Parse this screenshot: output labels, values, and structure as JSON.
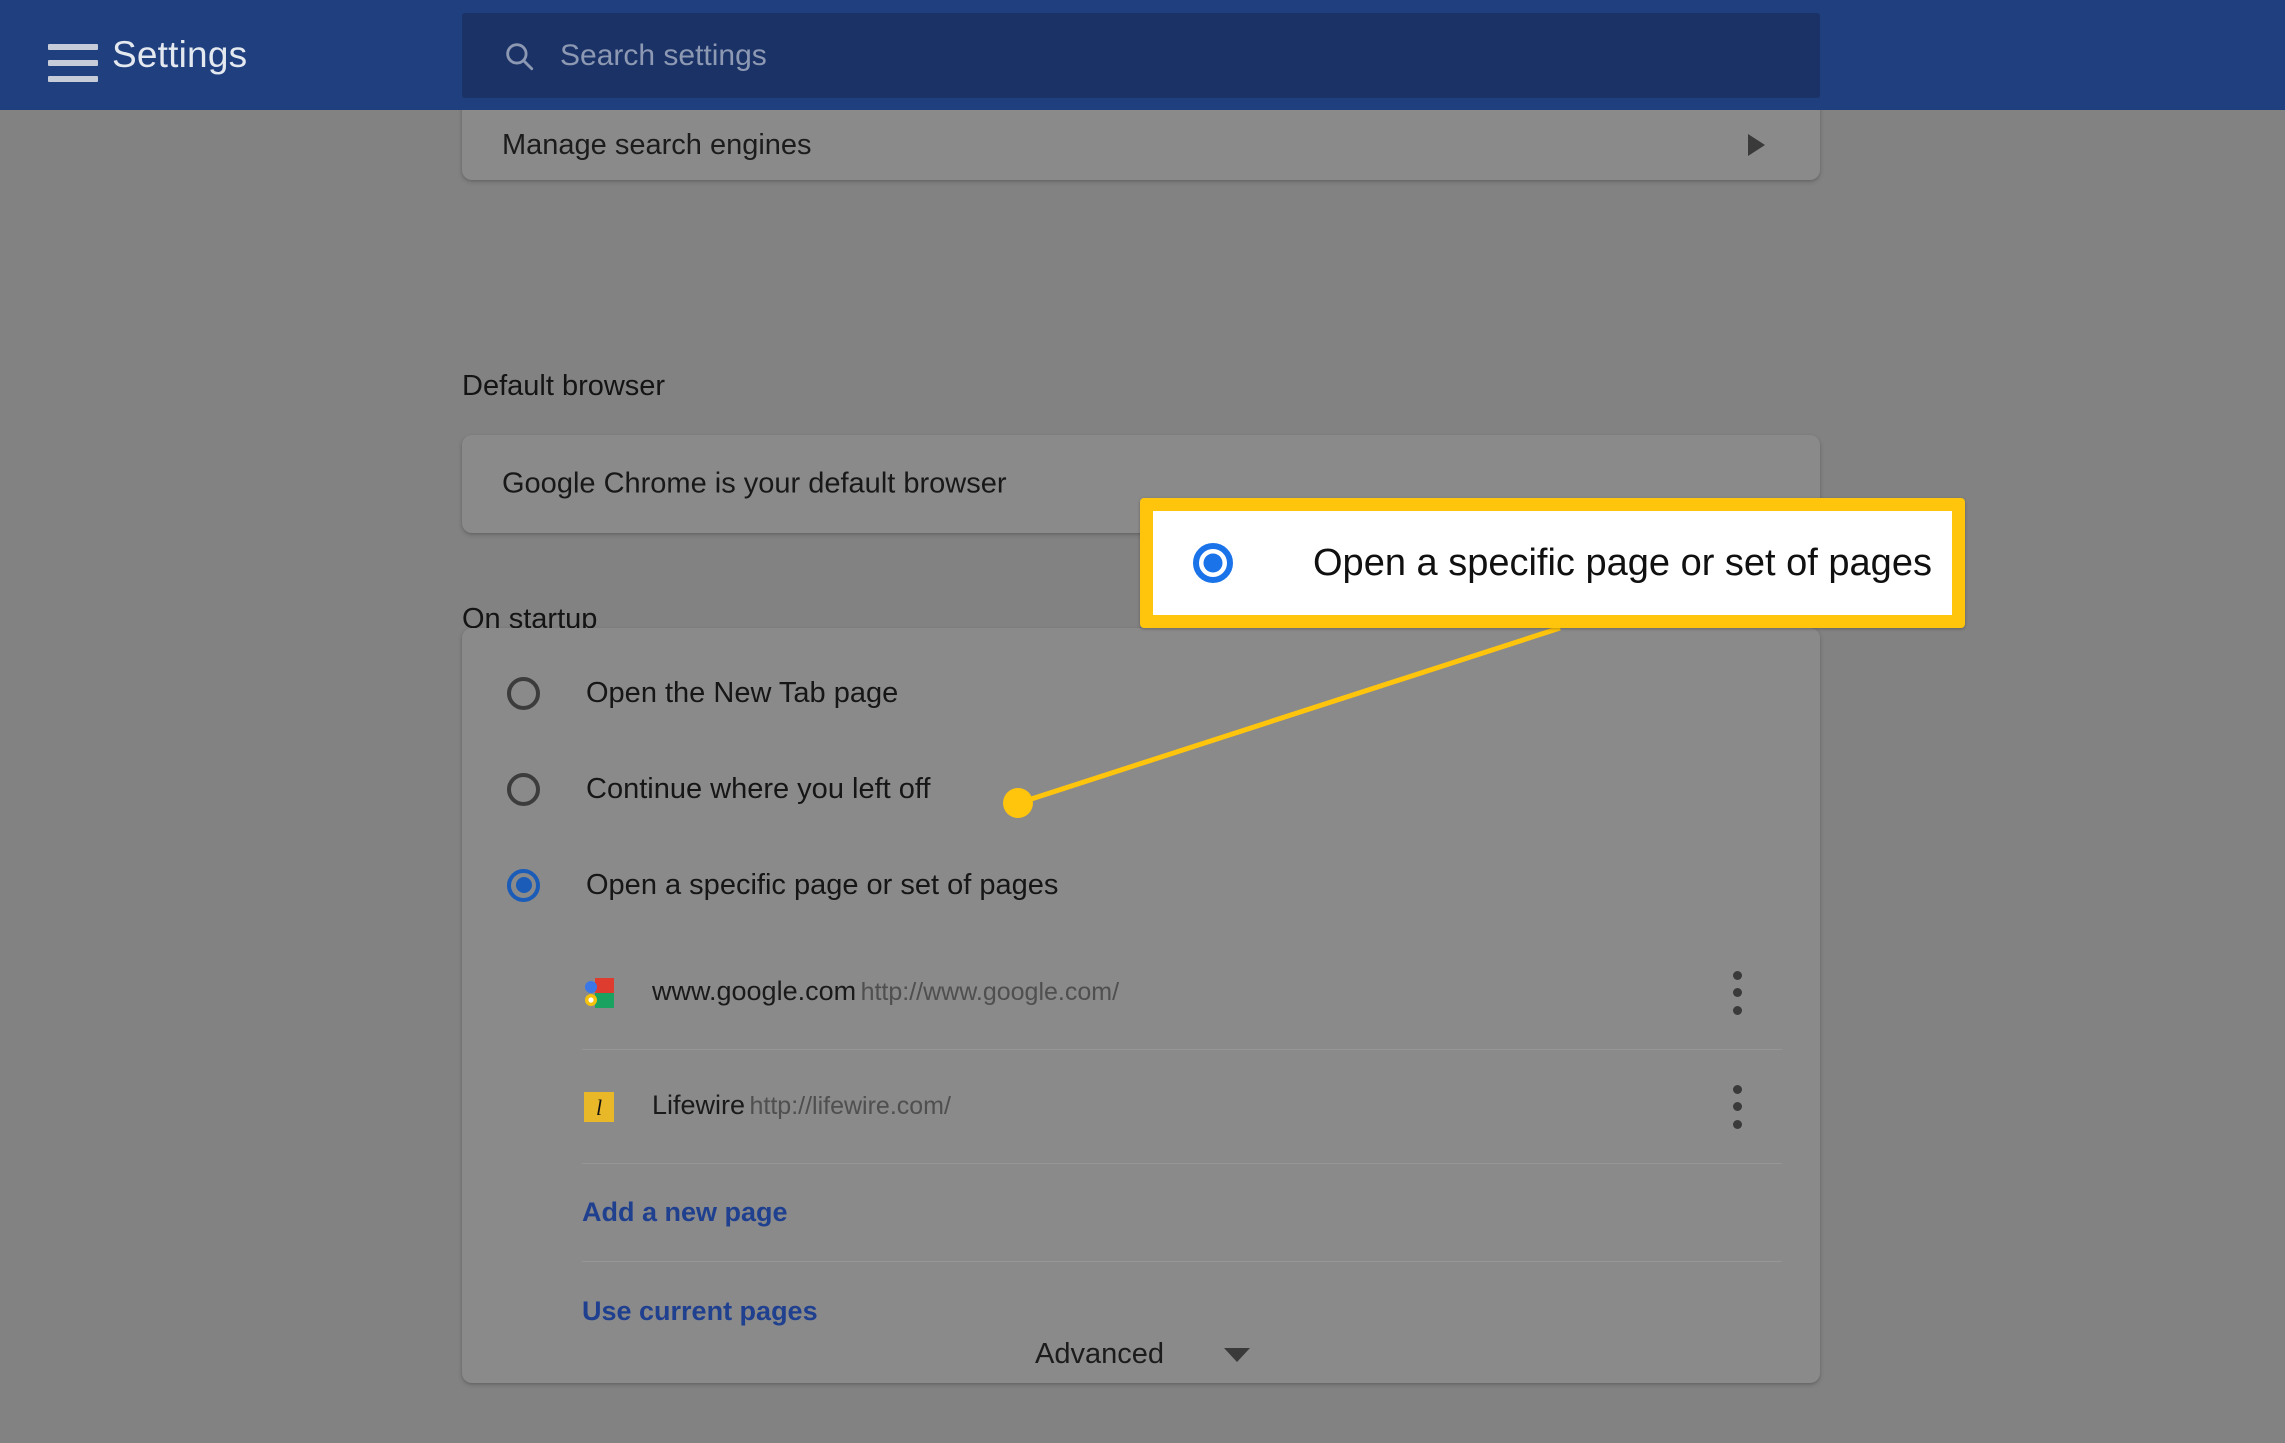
{
  "header": {
    "menu_icon": "hamburger-icon",
    "title": "Settings",
    "search": {
      "icon": "search-icon",
      "placeholder": "Search settings",
      "value": ""
    }
  },
  "content": {
    "manage_search_engines": {
      "label": "Manage search engines",
      "arrow_icon": "chevron-right-icon"
    },
    "default_browser": {
      "heading": "Default browser",
      "status": "Google Chrome is your default browser"
    },
    "on_startup": {
      "heading": "On startup",
      "options": [
        {
          "label": "Open the New Tab page",
          "selected": false
        },
        {
          "label": "Continue where you left off",
          "selected": false
        },
        {
          "label": "Open a specific page or set of pages",
          "selected": true
        }
      ],
      "pages": [
        {
          "favicon": "google-favicon",
          "title": "www.google.com",
          "url": "http://www.google.com/",
          "menu_icon": "more-vertical-icon"
        },
        {
          "favicon": "lifewire-favicon",
          "title": "Lifewire",
          "url": "http://lifewire.com/",
          "menu_icon": "more-vertical-icon"
        }
      ],
      "links": [
        {
          "label": "Add a new page"
        },
        {
          "label": "Use current pages"
        }
      ]
    },
    "advanced": {
      "label": "Advanced",
      "chevron_icon": "chevron-down-icon"
    }
  },
  "annotation": {
    "callout": {
      "text": "Open a specific page or set of pages",
      "radio_icon": "radio-selected-icon",
      "border_color": "#ffc40c",
      "background_color": "#ffffff",
      "radio_color": "#1a73e8"
    },
    "leader_line_color": "#ffc40c",
    "marker_dot_color": "#ffc40c"
  },
  "colors": {
    "header_background": "#1f3f7e",
    "search_background": "#1b3266",
    "page_dim_overlay": "#828282",
    "card_background": "#8a8a8a",
    "link_blue": "#1f3f8f",
    "radio_selected": "#1a5cb8"
  }
}
